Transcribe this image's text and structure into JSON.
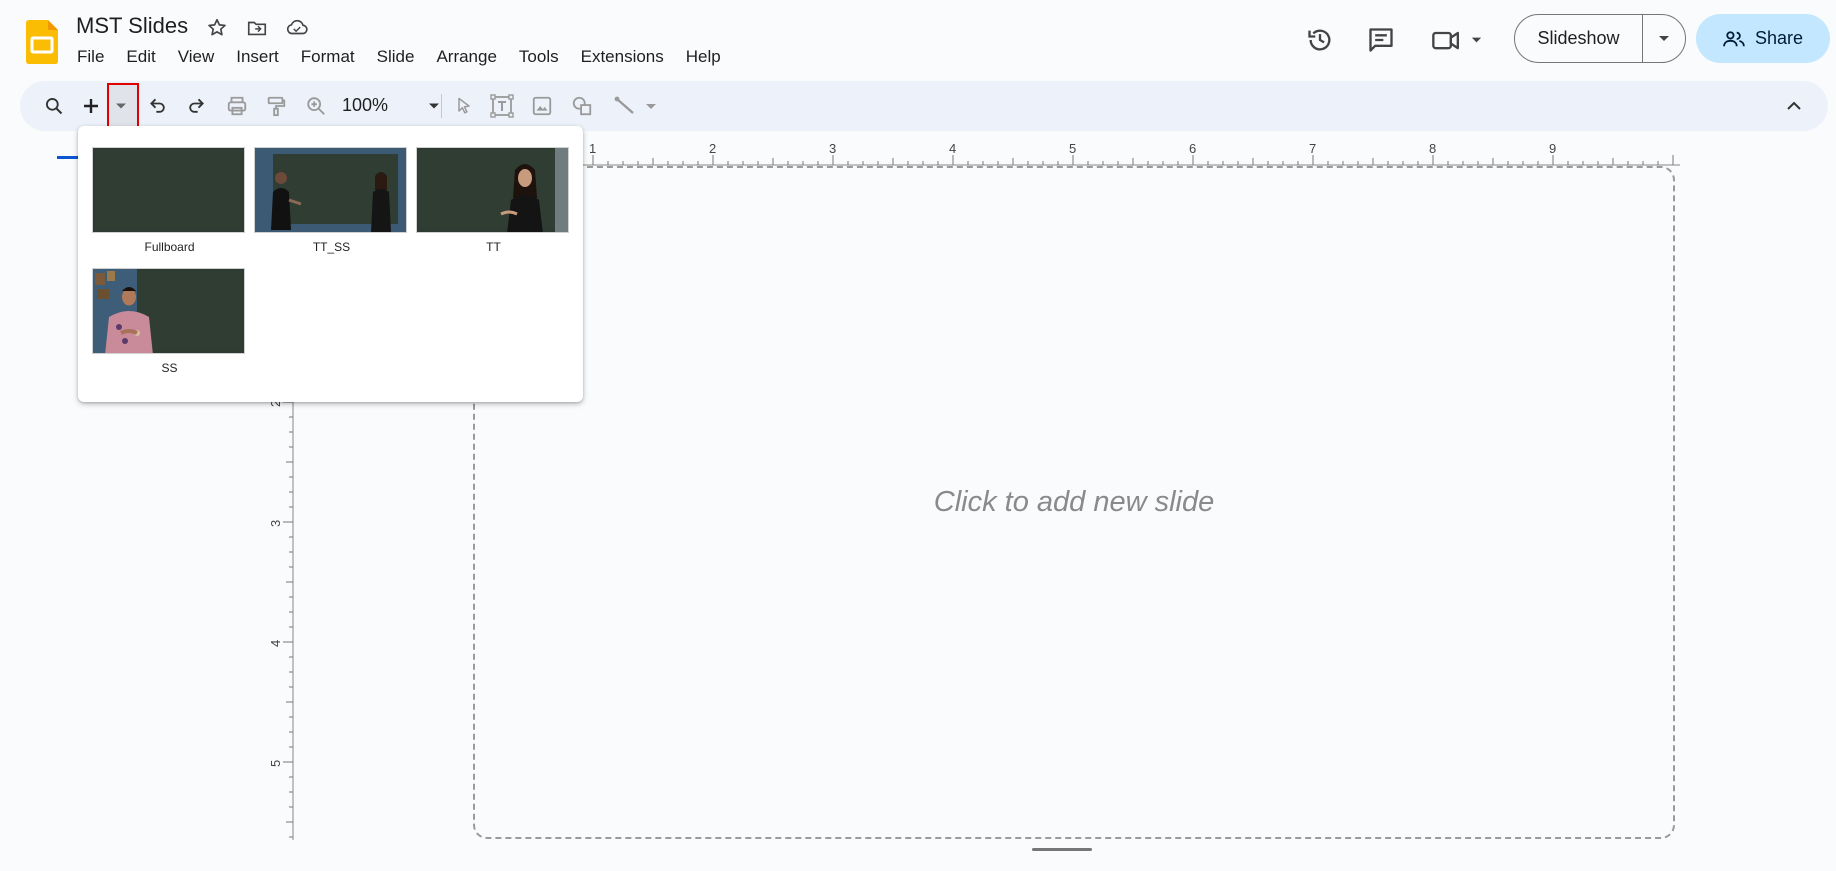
{
  "app": {
    "title": "MST Slides"
  },
  "menu": {
    "items": [
      "File",
      "Edit",
      "View",
      "Insert",
      "Format",
      "Slide",
      "Arrange",
      "Tools",
      "Extensions",
      "Help"
    ]
  },
  "header": {
    "slideshow_label": "Slideshow",
    "share_label": "Share"
  },
  "toolbar": {
    "zoom": "100%"
  },
  "rulers": {
    "top_marks": [
      "1",
      "2",
      "3",
      "4",
      "5",
      "6",
      "7",
      "8",
      "9"
    ],
    "left_marks": [
      "2",
      "3",
      "4",
      "5"
    ]
  },
  "slide": {
    "placeholder": "Click to add new slide"
  },
  "layouts": {
    "items": [
      {
        "label": "Fullboard",
        "people": 0
      },
      {
        "label": "TT_SS",
        "people": 2
      },
      {
        "label": "TT",
        "people": 1
      },
      {
        "label": "SS",
        "people": 1
      }
    ]
  },
  "colors": {
    "accent": "#0b57d0",
    "share_bg": "#c2e7ff",
    "toolbar_bg": "#edf2fa",
    "board_green": "#2f3d33",
    "highlight": "#e00000"
  }
}
